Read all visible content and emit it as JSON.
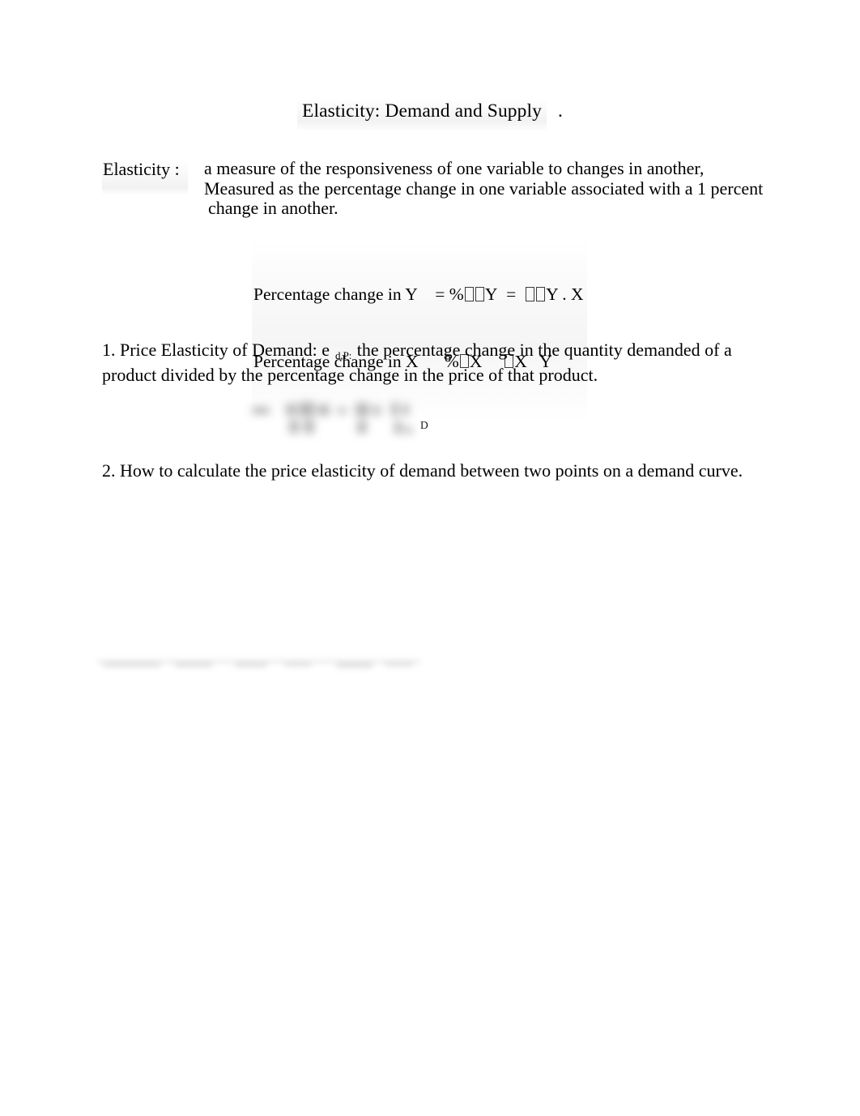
{
  "document": {
    "title_text": "Elasticity: Demand and Supply",
    "title_trailing_period": "."
  },
  "definition": {
    "term": "Elasticity :",
    "line1": "a measure of the responsiveness of one variable to changes in another,",
    "line2": "Measured as the percentage change in one variable associated with a 1 percent",
    "line3": "change in another."
  },
  "formula": {
    "numerator_label": "Percentage change in Y",
    "denominator_label": "Percentage change in X",
    "numerator_expr_a_pre": "= %",
    "numerator_expr_a_post": "Y",
    "numerator_expr_b_pre": "=",
    "numerator_expr_b_post": "Y . X",
    "denominator_expr_a_pre": "%",
    "denominator_expr_a_post": "X",
    "denominator_expr_b_post": "X   Y",
    "missing_glyph_note": "tofu-box"
  },
  "items": {
    "item1_lead": "1. Price Elasticity of Demand: e",
    "item1_subscript": "d,P:",
    "item1_body": " the percentage change in the quantity demanded of a product divided by the percentage change in the price of that product.",
    "item2": "2. How to calculate the price elasticity of demand between two points on a demand curve."
  },
  "graphic": {
    "blurred_formula_subscript": "D"
  },
  "colors": {
    "page_background": "#ffffff",
    "text": "#000000",
    "highlight_shade": "#f0f0f0",
    "smudge": "#9a9a9a"
  }
}
